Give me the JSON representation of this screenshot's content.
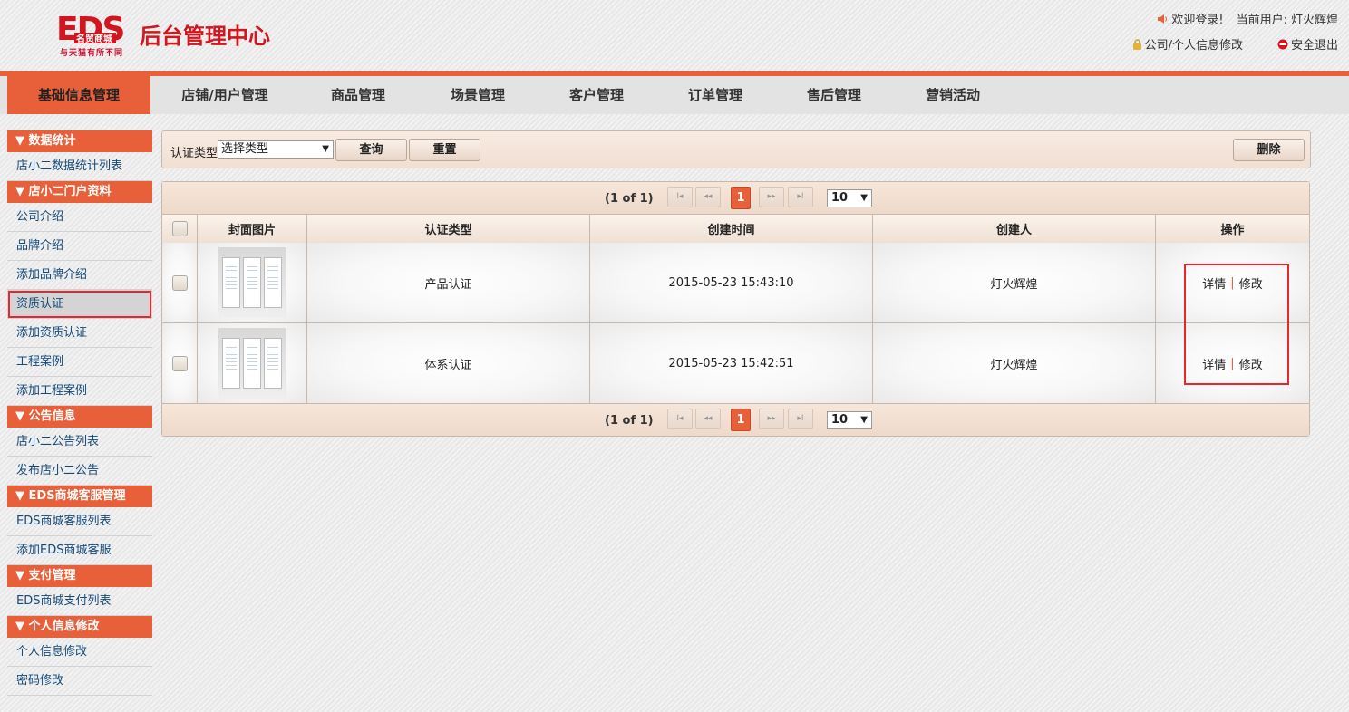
{
  "header": {
    "logo_text": "EDS",
    "logo_sub": "名贸商城",
    "logo_tagline": "与天猫有所不同",
    "system_title": "后台管理中心",
    "welcome": "欢迎登录!",
    "current_user_label": "当前用户:",
    "current_user": "灯火辉煌",
    "profile_link": "公司/个人信息修改",
    "logout_link": "安全退出"
  },
  "nav": {
    "items": [
      "基础信息管理",
      "店铺/用户管理",
      "商品管理",
      "场景管理",
      "客户管理",
      "订单管理",
      "售后管理",
      "营销活动"
    ],
    "active_index": 0
  },
  "sidebar": {
    "groups": [
      {
        "title": "▼ 数据统计",
        "items": [
          "店小二数据统计列表"
        ]
      },
      {
        "title": "▼ 店小二门户资料",
        "items": [
          "公司介绍",
          "品牌介绍",
          "添加品牌介绍",
          "资质认证",
          "添加资质认证",
          "工程案例",
          "添加工程案例"
        ]
      },
      {
        "title": "▼ 公告信息",
        "items": [
          "店小二公告列表",
          "发布店小二公告"
        ]
      },
      {
        "title": "▼ EDS商城客服管理",
        "items": [
          "EDS商城客服列表",
          "添加EDS商城客服"
        ]
      },
      {
        "title": "▼ 支付管理",
        "items": [
          "EDS商城支付列表"
        ]
      },
      {
        "title": "▼ 个人信息修改",
        "items": [
          "个人信息修改",
          "密码修改"
        ]
      }
    ],
    "selected_item": "资质认证"
  },
  "filter": {
    "label": "认证类型",
    "select_value": "选择类型",
    "query_button": "查询",
    "reset_button": "重置",
    "delete_button": "删除"
  },
  "pager": {
    "info": "(1 of 1)",
    "first": "I◂",
    "prev": "◂◂",
    "current_page": "1",
    "next": "▸▸",
    "last": "▸I",
    "page_size": "10"
  },
  "table": {
    "columns": [
      "",
      "封面图片",
      "认证类型",
      "创建时间",
      "创建人",
      "操作"
    ],
    "rows": [
      {
        "type": "产品认证",
        "created": "2015-05-23 15:43:10",
        "creator": "灯火辉煌",
        "detail": "详情",
        "edit": "修改"
      },
      {
        "type": "体系认证",
        "created": "2015-05-23 15:42:51",
        "creator": "灯火辉煌",
        "detail": "详情",
        "edit": "修改"
      }
    ]
  },
  "colors": {
    "accent": "#e8603a",
    "highlight_border": "#e8262e",
    "logo_red": "#d2151e"
  }
}
